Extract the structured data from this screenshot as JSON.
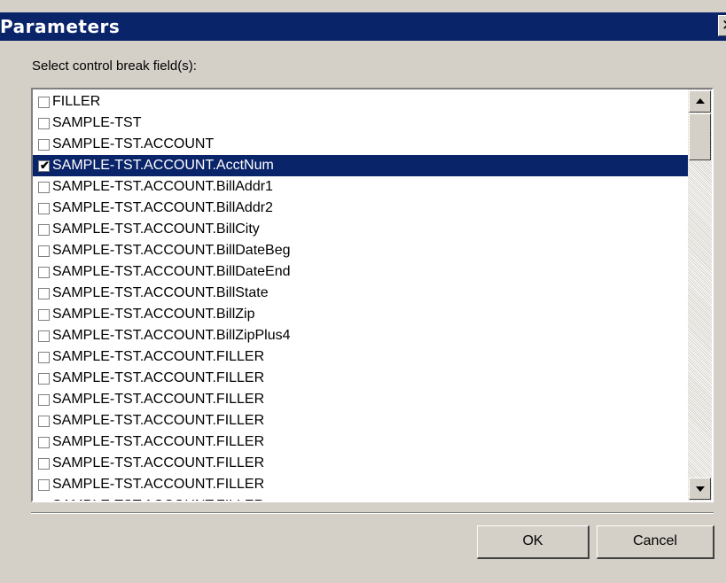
{
  "window": {
    "title": "Parameters",
    "close_glyph": "✕"
  },
  "prompt": "Select control break field(s):",
  "fields": [
    {
      "label": "FILLER",
      "checked": false,
      "selected": false
    },
    {
      "label": "SAMPLE-TST",
      "checked": false,
      "selected": false
    },
    {
      "label": "SAMPLE-TST.ACCOUNT",
      "checked": false,
      "selected": false
    },
    {
      "label": "SAMPLE-TST.ACCOUNT.AcctNum",
      "checked": true,
      "selected": true
    },
    {
      "label": "SAMPLE-TST.ACCOUNT.BillAddr1",
      "checked": false,
      "selected": false
    },
    {
      "label": "SAMPLE-TST.ACCOUNT.BillAddr2",
      "checked": false,
      "selected": false
    },
    {
      "label": "SAMPLE-TST.ACCOUNT.BillCity",
      "checked": false,
      "selected": false
    },
    {
      "label": "SAMPLE-TST.ACCOUNT.BillDateBeg",
      "checked": false,
      "selected": false
    },
    {
      "label": "SAMPLE-TST.ACCOUNT.BillDateEnd",
      "checked": false,
      "selected": false
    },
    {
      "label": "SAMPLE-TST.ACCOUNT.BillState",
      "checked": false,
      "selected": false
    },
    {
      "label": "SAMPLE-TST.ACCOUNT.BillZip",
      "checked": false,
      "selected": false
    },
    {
      "label": "SAMPLE-TST.ACCOUNT.BillZipPlus4",
      "checked": false,
      "selected": false
    },
    {
      "label": "SAMPLE-TST.ACCOUNT.FILLER",
      "checked": false,
      "selected": false
    },
    {
      "label": "SAMPLE-TST.ACCOUNT.FILLER",
      "checked": false,
      "selected": false
    },
    {
      "label": "SAMPLE-TST.ACCOUNT.FILLER",
      "checked": false,
      "selected": false
    },
    {
      "label": "SAMPLE-TST.ACCOUNT.FILLER",
      "checked": false,
      "selected": false
    },
    {
      "label": "SAMPLE-TST.ACCOUNT.FILLER",
      "checked": false,
      "selected": false
    },
    {
      "label": "SAMPLE-TST.ACCOUNT.FILLER",
      "checked": false,
      "selected": false
    },
    {
      "label": "SAMPLE-TST.ACCOUNT.FILLER",
      "checked": false,
      "selected": false
    },
    {
      "label": "SAMPLE-TST.ACCOUNT.FILLER",
      "checked": false,
      "selected": false
    }
  ],
  "buttons": {
    "ok": "OK",
    "cancel": "Cancel"
  },
  "colors": {
    "title_bar": "#0a246a",
    "dialog_face": "#d4d0c8",
    "selection": "#0a246a"
  },
  "icons": {
    "check": "checkmark-icon",
    "scroll_up": "up-arrow-icon",
    "scroll_down": "down-arrow-icon",
    "close": "close-icon"
  }
}
